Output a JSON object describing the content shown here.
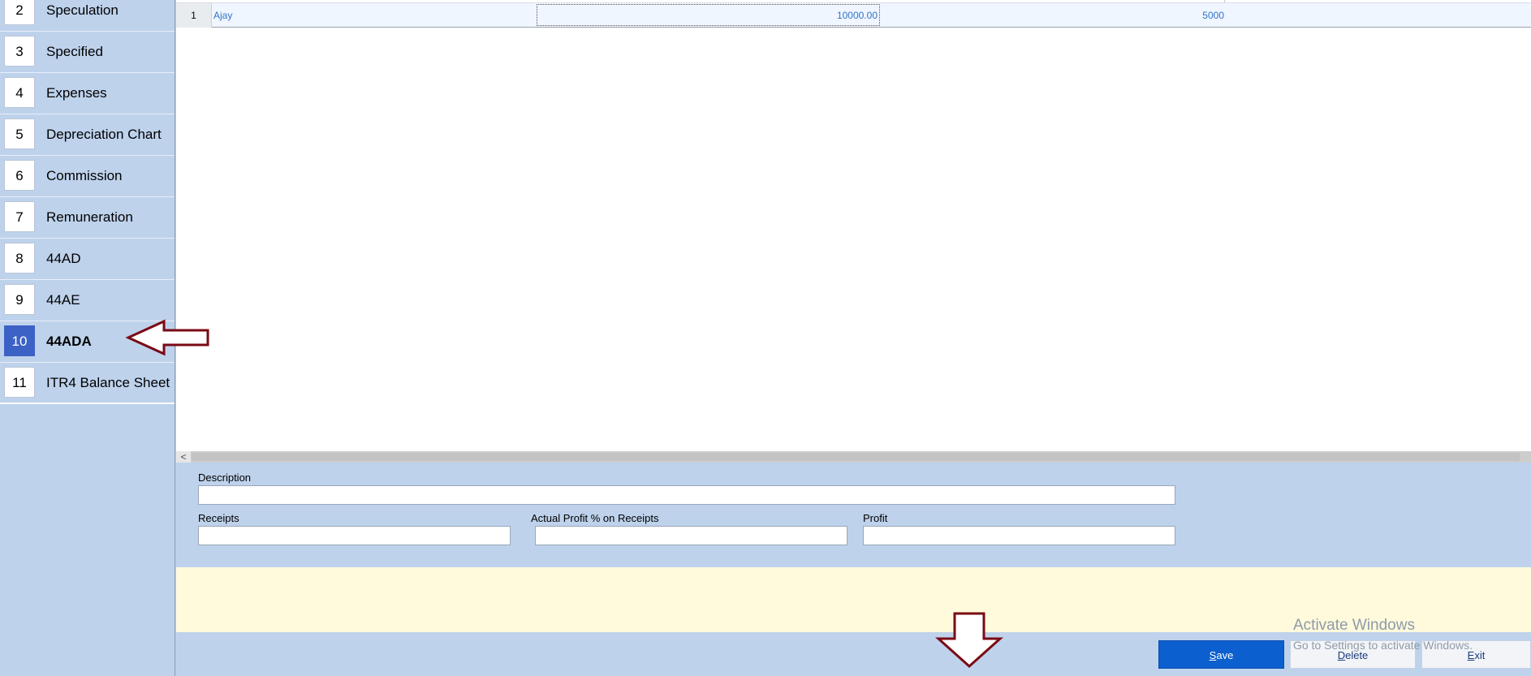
{
  "sidebar": {
    "items": [
      {
        "num": "2",
        "label": "Speculation"
      },
      {
        "num": "3",
        "label": "Specified"
      },
      {
        "num": "4",
        "label": "Expenses"
      },
      {
        "num": "5",
        "label": "Depreciation Chart"
      },
      {
        "num": "6",
        "label": "Commission"
      },
      {
        "num": "7",
        "label": "Remuneration"
      },
      {
        "num": "8",
        "label": "44AD"
      },
      {
        "num": "9",
        "label": "44AE"
      },
      {
        "num": "10",
        "label": "44ADA"
      },
      {
        "num": "11",
        "label": "ITR4 Balance Sheet"
      }
    ],
    "active_index": 8
  },
  "grid": {
    "rows": [
      {
        "num": "1",
        "name": "Ajay",
        "amount": "10000.00",
        "value": "5000"
      }
    ]
  },
  "scrollbar": {
    "left_arrow": "<"
  },
  "form": {
    "description_label": "Description",
    "description_value": "",
    "receipts_label": "Receipts",
    "receipts_value": "",
    "profit_pct_label": "Actual Profit % on Receipts",
    "profit_pct_value": "",
    "profit_label": "Profit",
    "profit_value": ""
  },
  "buttons": {
    "save_mnemonic": "S",
    "save_rest": "ave",
    "delete_mnemonic": "D",
    "delete_rest": "elete",
    "exit_mnemonic": "E",
    "exit_rest": "xit"
  },
  "watermark": {
    "title": "Activate Windows",
    "subtitle": "Go to Settings to activate Windows."
  },
  "colors": {
    "panel_bg": "#bed2ec",
    "active_item": "#3d62c6",
    "save_button": "#0b5fce",
    "info_panel": "#fffadc",
    "annotation_arrow": "#7a0a14",
    "grid_text": "#2f74c9"
  }
}
